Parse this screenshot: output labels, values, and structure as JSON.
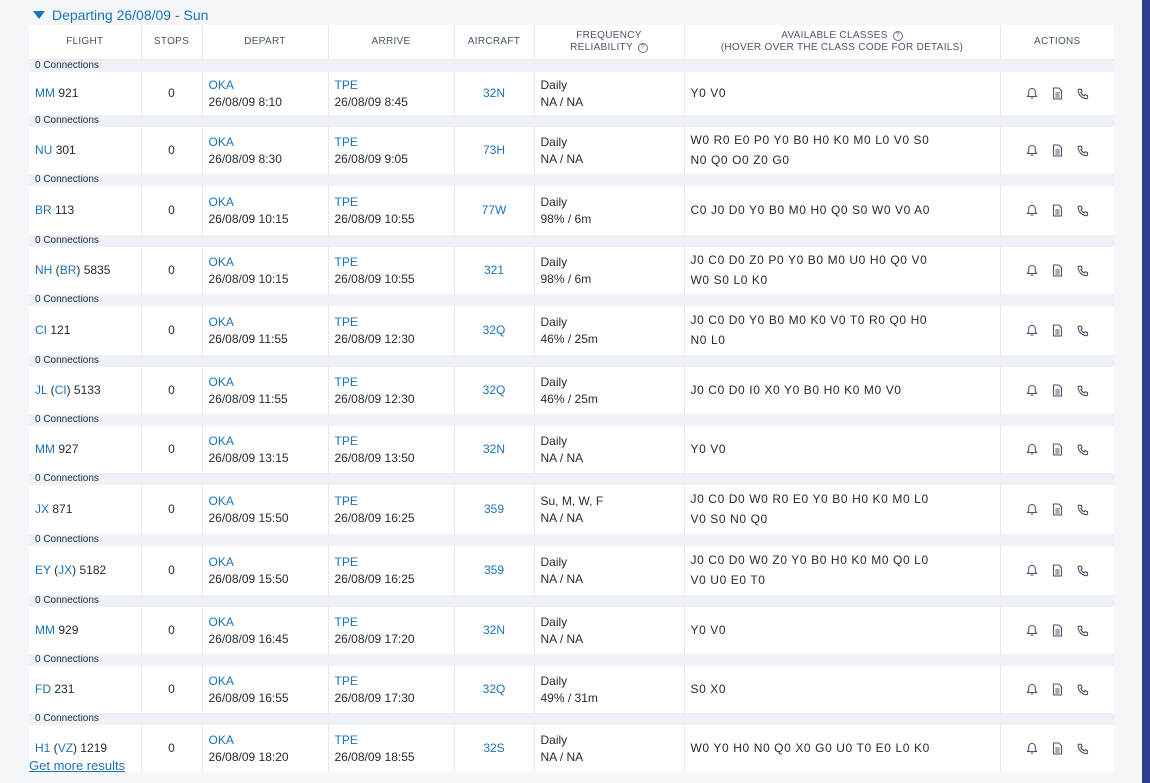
{
  "header": {
    "departing_label": "Departing 26/08/09 - Sun"
  },
  "columns": {
    "flight": "FLIGHT",
    "stops": "STOPS",
    "depart": "DEPART",
    "arrive": "ARRIVE",
    "aircraft": "AIRCRAFT",
    "frequency_line1": "FREQUENCY",
    "frequency_line2": "RELIABILITY",
    "classes_line1": "AVAILABLE CLASSES",
    "classes_line2": "(HOVER OVER THE CLASS CODE FOR DETAILS)",
    "actions": "ACTIONS"
  },
  "rows": [
    {
      "connections": "0 Connections",
      "airline": "MM",
      "op": "",
      "num": "921",
      "stops": "0",
      "dep_code": "OKA",
      "dep_time": "26/08/09 8:10",
      "arr_code": "TPE",
      "arr_time": "26/08/09 8:45",
      "aircraft": "32N",
      "freq": "Daily",
      "rel": "NA / NA",
      "classes1": "Y0 V0",
      "classes2": ""
    },
    {
      "connections": "0 Connections",
      "airline": "NU",
      "op": "",
      "num": "301",
      "stops": "0",
      "dep_code": "OKA",
      "dep_time": "26/08/09 8:30",
      "arr_code": "TPE",
      "arr_time": "26/08/09 9:05",
      "aircraft": "73H",
      "freq": "Daily",
      "rel": "NA / NA",
      "classes1": "W0 R0 E0 P0 Y0 B0 H0 K0 M0 L0 V0 S0",
      "classes2": "N0 Q0 O0 Z0 G0"
    },
    {
      "connections": "0 Connections",
      "airline": "BR",
      "op": "",
      "num": "113",
      "stops": "0",
      "dep_code": "OKA",
      "dep_time": "26/08/09 10:15",
      "arr_code": "TPE",
      "arr_time": "26/08/09 10:55",
      "aircraft": "77W",
      "freq": "Daily",
      "rel": "98% / 6m",
      "classes1": "C0 J0 D0 Y0 B0 M0 H0 Q0 S0 W0 V0 A0",
      "classes2": ""
    },
    {
      "connections": "0 Connections",
      "airline": "NH",
      "op": "BR",
      "num": "5835",
      "stops": "0",
      "dep_code": "OKA",
      "dep_time": "26/08/09 10:15",
      "arr_code": "TPE",
      "arr_time": "26/08/09 10:55",
      "aircraft": "321",
      "freq": "Daily",
      "rel": "98% / 6m",
      "classes1": "J0 C0 D0 Z0 P0 Y0 B0 M0 U0 H0 Q0 V0",
      "classes2": "W0 S0 L0 K0"
    },
    {
      "connections": "0 Connections",
      "airline": "CI",
      "op": "",
      "num": "121",
      "stops": "0",
      "dep_code": "OKA",
      "dep_time": "26/08/09 11:55",
      "arr_code": "TPE",
      "arr_time": "26/08/09 12:30",
      "aircraft": "32Q",
      "freq": "Daily",
      "rel": "46% / 25m",
      "classes1": "J0 C0 D0 Y0 B0 M0 K0 V0 T0 R0 Q0 H0",
      "classes2": "N0 L0"
    },
    {
      "connections": "0 Connections",
      "airline": "JL",
      "op": "CI",
      "num": "5133",
      "stops": "0",
      "dep_code": "OKA",
      "dep_time": "26/08/09 11:55",
      "arr_code": "TPE",
      "arr_time": "26/08/09 12:30",
      "aircraft": "32Q",
      "freq": "Daily",
      "rel": "46% / 25m",
      "classes1": "J0 C0 D0 I0 X0 Y0 B0 H0 K0 M0 V0",
      "classes2": ""
    },
    {
      "connections": "0 Connections",
      "airline": "MM",
      "op": "",
      "num": "927",
      "stops": "0",
      "dep_code": "OKA",
      "dep_time": "26/08/09 13:15",
      "arr_code": "TPE",
      "arr_time": "26/08/09 13:50",
      "aircraft": "32N",
      "freq": "Daily",
      "rel": "NA / NA",
      "classes1": "Y0 V0",
      "classes2": ""
    },
    {
      "connections": "0 Connections",
      "airline": "JX",
      "op": "",
      "num": "871",
      "stops": "0",
      "dep_code": "OKA",
      "dep_time": "26/08/09 15:50",
      "arr_code": "TPE",
      "arr_time": "26/08/09 16:25",
      "aircraft": "359",
      "freq": "Su, M, W, F",
      "rel": "NA / NA",
      "classes1": "J0 C0 D0 W0 R0 E0 Y0 B0 H0 K0 M0 L0",
      "classes2": "V0 S0 N0 Q0"
    },
    {
      "connections": "0 Connections",
      "airline": "EY",
      "op": "JX",
      "num": "5182",
      "stops": "0",
      "dep_code": "OKA",
      "dep_time": "26/08/09 15:50",
      "arr_code": "TPE",
      "arr_time": "26/08/09 16:25",
      "aircraft": "359",
      "freq": "Daily",
      "rel": "NA / NA",
      "classes1": "J0 C0 D0 W0 Z0 Y0 B0 H0 K0 M0 Q0 L0",
      "classes2": "V0 U0 E0 T0"
    },
    {
      "connections": "0 Connections",
      "airline": "MM",
      "op": "",
      "num": "929",
      "stops": "0",
      "dep_code": "OKA",
      "dep_time": "26/08/09 16:45",
      "arr_code": "TPE",
      "arr_time": "26/08/09 17:20",
      "aircraft": "32N",
      "freq": "Daily",
      "rel": "NA / NA",
      "classes1": "Y0 V0",
      "classes2": ""
    },
    {
      "connections": "0 Connections",
      "airline": "FD",
      "op": "",
      "num": "231",
      "stops": "0",
      "dep_code": "OKA",
      "dep_time": "26/08/09 16:55",
      "arr_code": "TPE",
      "arr_time": "26/08/09 17:30",
      "aircraft": "32Q",
      "freq": "Daily",
      "rel": "49% / 31m",
      "classes1": "S0 X0",
      "classes2": ""
    },
    {
      "connections": "0 Connections",
      "airline": "H1",
      "op": "VZ",
      "num": "1219",
      "stops": "0",
      "dep_code": "OKA",
      "dep_time": "26/08/09 18:20",
      "arr_code": "TPE",
      "arr_time": "26/08/09 18:55",
      "aircraft": "32S",
      "freq": "Daily",
      "rel": "NA / NA",
      "classes1": "W0 Y0 H0 N0 Q0 X0 G0 U0 T0 E0 L0 K0",
      "classes2": ""
    }
  ],
  "footer": {
    "more_label": "Get more results"
  },
  "icons": {
    "alert": "bell-icon",
    "details": "document-icon",
    "contact": "phone-icon"
  },
  "colors": {
    "link": "#1a73b8",
    "connection_band": "#eef1f5",
    "side_bar": "#2c3e8f"
  }
}
